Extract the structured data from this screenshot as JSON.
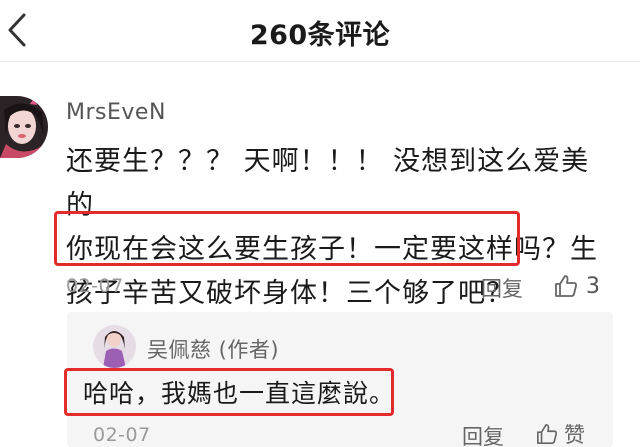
{
  "header": {
    "back_icon": "chevron-left-icon",
    "title": "260条评论"
  },
  "comment": {
    "username": "MrsEveN",
    "lines": [
      "还要生？？？ 天啊！！！ 没想到这么爱美的",
      "你现在会这么要生孩子！一定要这样吗？生",
      "孩子辛苦又破坏身体！三个够了吧？"
    ],
    "date": "02-07",
    "reply_label": "回复",
    "like_icon": "thumbs-up-icon",
    "like_count": "3"
  },
  "reply": {
    "author": "吴佩慈 (作者)",
    "text": "哈哈，我媽也一直這麼說。",
    "date": "02-07",
    "reply_label": "回复",
    "like_icon": "thumbs-up-icon",
    "like_label": "赞"
  },
  "colors": {
    "highlight": "#e32b2b",
    "reply_background": "#f5f5f5",
    "meta_text": "#9a9a9a"
  }
}
